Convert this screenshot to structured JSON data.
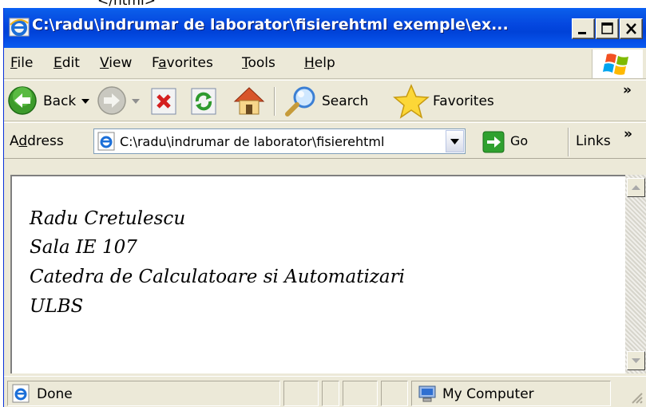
{
  "document_fragment": "</html>",
  "window": {
    "title": "C:\\radu\\indrumar de laborator\\fisierehtml exemple\\ex..."
  },
  "menu": [
    {
      "label": "File",
      "hotkey": "F",
      "rest": "ile"
    },
    {
      "label": "Edit",
      "hotkey": "E",
      "rest": "dit"
    },
    {
      "label": "View",
      "hotkey": "V",
      "rest": "iew"
    },
    {
      "label": "Favorites",
      "pre": "F",
      "hotkey": "a",
      "rest": "vorites"
    },
    {
      "label": "Tools",
      "hotkey": "T",
      "rest": "ools"
    },
    {
      "label": "Help",
      "hotkey": "H",
      "rest": "elp"
    }
  ],
  "toolbar": {
    "back_label": "Back",
    "search_label": "Search",
    "favorites_label": "Favorites",
    "overflow": "»"
  },
  "address": {
    "label_pre": "A",
    "label_hotkey": "d",
    "label_rest": "dress",
    "value": "C:\\radu\\indrumar de laborator\\fisierehtml",
    "go_label": "Go",
    "links_label": "Links",
    "overflow": "»"
  },
  "page": {
    "lines": [
      "Radu Cretulescu",
      "Sala IE 107",
      "Catedra de Calculatoare si Automatizari",
      "ULBS"
    ]
  },
  "status": {
    "text": "Done",
    "zone": "My Computer"
  }
}
